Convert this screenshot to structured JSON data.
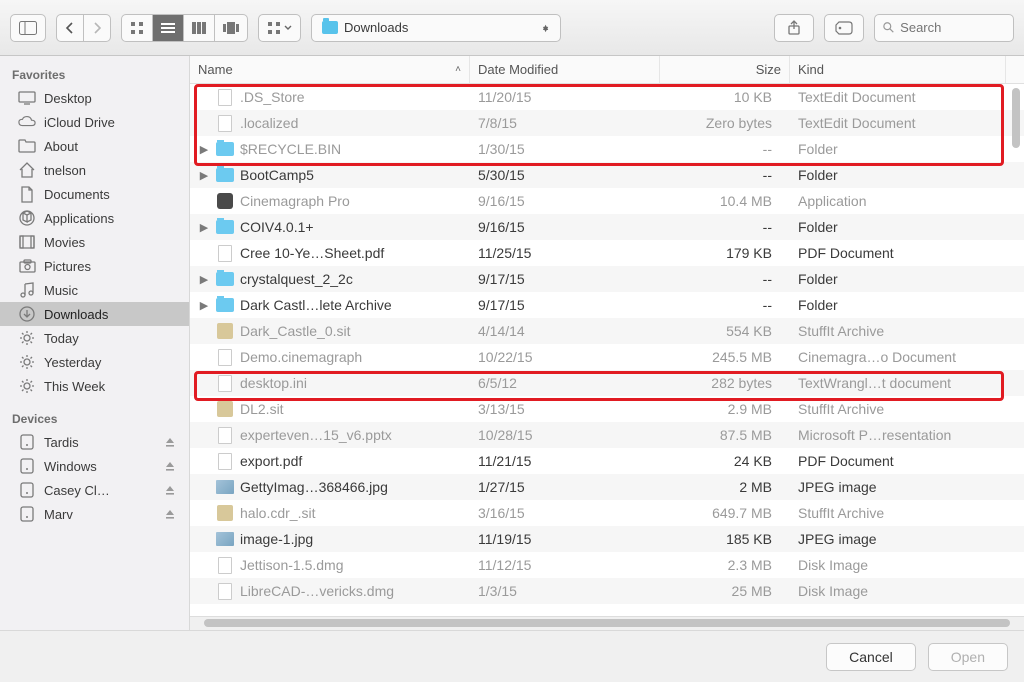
{
  "toolbar": {
    "location_label": "Downloads",
    "search_placeholder": "Search"
  },
  "sidebar": {
    "favorites_header": "Favorites",
    "devices_header": "Devices",
    "favorites": [
      {
        "label": "Desktop",
        "icon": "desktop"
      },
      {
        "label": "iCloud Drive",
        "icon": "cloud"
      },
      {
        "label": "About",
        "icon": "folder"
      },
      {
        "label": "tnelson",
        "icon": "home"
      },
      {
        "label": "Documents",
        "icon": "doc"
      },
      {
        "label": "Applications",
        "icon": "app"
      },
      {
        "label": "Movies",
        "icon": "movies"
      },
      {
        "label": "Pictures",
        "icon": "pictures"
      },
      {
        "label": "Music",
        "icon": "music"
      },
      {
        "label": "Downloads",
        "icon": "downloads",
        "selected": true
      },
      {
        "label": "Today",
        "icon": "gear"
      },
      {
        "label": "Yesterday",
        "icon": "gear"
      },
      {
        "label": "This Week",
        "icon": "gear"
      }
    ],
    "devices": [
      {
        "label": "Tardis",
        "icon": "disk",
        "eject": true
      },
      {
        "label": "Windows",
        "icon": "disk",
        "eject": true
      },
      {
        "label": "Casey Cl…",
        "icon": "disk",
        "eject": true
      },
      {
        "label": "Marv",
        "icon": "disk",
        "eject": true
      }
    ]
  },
  "columns": {
    "name": "Name",
    "date": "Date Modified",
    "size": "Size",
    "kind": "Kind"
  },
  "files": [
    {
      "name": ".DS_Store",
      "date": "11/20/15",
      "size": "10 KB",
      "kind": "TextEdit Document",
      "dim": true,
      "icon": "doc"
    },
    {
      "name": ".localized",
      "date": "7/8/15",
      "size": "Zero bytes",
      "kind": "TextEdit Document",
      "dim": true,
      "icon": "doc"
    },
    {
      "name": "$RECYCLE.BIN",
      "date": "1/30/15",
      "size": "--",
      "kind": "Folder",
      "dim": true,
      "icon": "folder",
      "expandable": true
    },
    {
      "name": "BootCamp5",
      "date": "5/30/15",
      "size": "--",
      "kind": "Folder",
      "icon": "folder",
      "expandable": true
    },
    {
      "name": "Cinemagraph Pro",
      "date": "9/16/15",
      "size": "10.4 MB",
      "kind": "Application",
      "dim": true,
      "icon": "app"
    },
    {
      "name": "COIV4.0.1+",
      "date": "9/16/15",
      "size": "--",
      "kind": "Folder",
      "icon": "folder",
      "expandable": true
    },
    {
      "name": "Cree 10-Ye…Sheet.pdf",
      "date": "11/25/15",
      "size": "179 KB",
      "kind": "PDF Document",
      "icon": "doc"
    },
    {
      "name": "crystalquest_2_2c",
      "date": "9/17/15",
      "size": "--",
      "kind": "Folder",
      "icon": "folder",
      "expandable": true
    },
    {
      "name": "Dark Castl…lete Archive",
      "date": "9/17/15",
      "size": "--",
      "kind": "Folder",
      "icon": "folder",
      "expandable": true
    },
    {
      "name": "Dark_Castle_0.sit",
      "date": "4/14/14",
      "size": "554 KB",
      "kind": "StuffIt Archive",
      "dim": true,
      "icon": "arch"
    },
    {
      "name": "Demo.cinemagraph",
      "date": "10/22/15",
      "size": "245.5 MB",
      "kind": "Cinemagra…o Document",
      "dim": true,
      "icon": "doc"
    },
    {
      "name": "desktop.ini",
      "date": "6/5/12",
      "size": "282 bytes",
      "kind": "TextWrangl…t document",
      "dim": true,
      "icon": "doc"
    },
    {
      "name": "DL2.sit",
      "date": "3/13/15",
      "size": "2.9 MB",
      "kind": "StuffIt Archive",
      "dim": true,
      "icon": "arch"
    },
    {
      "name": "experteven…15_v6.pptx",
      "date": "10/28/15",
      "size": "87.5 MB",
      "kind": "Microsoft P…resentation",
      "dim": true,
      "icon": "doc"
    },
    {
      "name": "export.pdf",
      "date": "11/21/15",
      "size": "24 KB",
      "kind": "PDF Document",
      "icon": "doc"
    },
    {
      "name": "GettyImag…368466.jpg",
      "date": "1/27/15",
      "size": "2 MB",
      "kind": "JPEG image",
      "icon": "img"
    },
    {
      "name": "halo.cdr_.sit",
      "date": "3/16/15",
      "size": "649.7 MB",
      "kind": "StuffIt Archive",
      "dim": true,
      "icon": "arch"
    },
    {
      "name": "image-1.jpg",
      "date": "11/19/15",
      "size": "185 KB",
      "kind": "JPEG image",
      "icon": "img"
    },
    {
      "name": "Jettison-1.5.dmg",
      "date": "11/12/15",
      "size": "2.3 MB",
      "kind": "Disk Image",
      "dim": true,
      "icon": "doc"
    },
    {
      "name": "LibreCAD-…vericks.dmg",
      "date": "1/3/15",
      "size": "25 MB",
      "kind": "Disk Image",
      "dim": true,
      "icon": "doc"
    }
  ],
  "footer": {
    "cancel": "Cancel",
    "open": "Open"
  }
}
